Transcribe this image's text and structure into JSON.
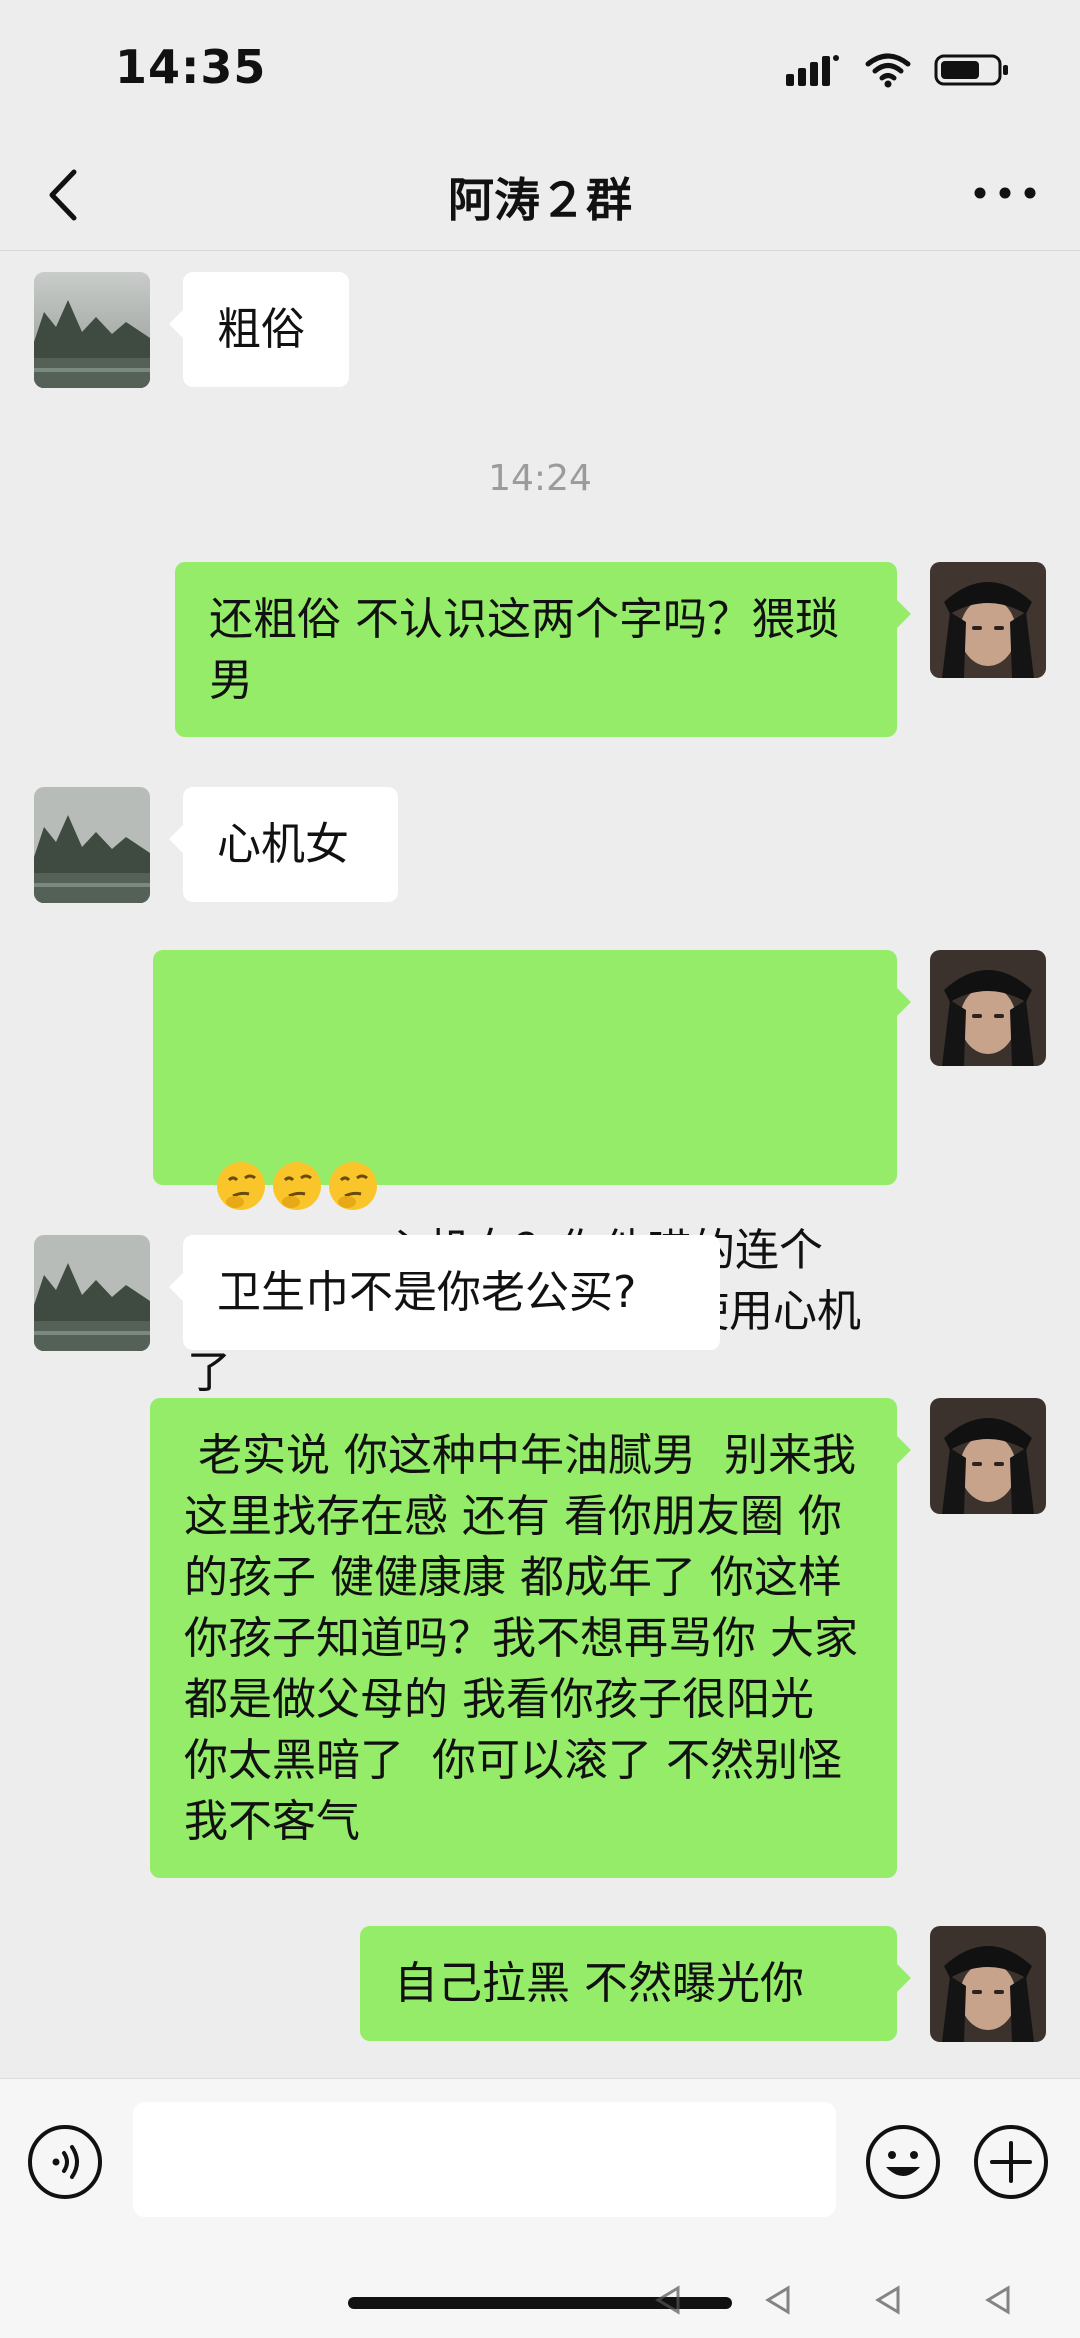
{
  "status_bar": {
    "time": "14:35"
  },
  "nav": {
    "title": "阿涛２群"
  },
  "timestamp": "14:24",
  "messages": [
    {
      "side": "in",
      "text": "粗俗"
    },
    {
      "side": "out",
      "text": "还粗俗 不认识这两个字吗？猥琐男"
    },
    {
      "side": "in",
      "text": "心机女"
    },
    {
      "side": "out",
      "emoji_count": 3,
      "emoji": "thinking-emoji",
      "text": "心机女？你他喵的连个卫生巾都没买过 何来对你使用心机了"
    },
    {
      "side": "in",
      "text": "卫生巾不是你老公买?"
    },
    {
      "side": "out",
      "text": " 老实说 你这种中年油腻男  别来我这里找存在感 还有 看你朋友圈 你的孩子 健健康康 都成年了 你这样 你孩子知道吗？我不想再骂你 大家都是做父母的 我看你孩子很阳光 你太黑暗了  你可以滚了 不然别怪我不客气"
    },
    {
      "side": "out",
      "text": "自己拉黑 不然曝光你"
    }
  ],
  "input": {
    "value": ""
  },
  "icons": {
    "signal": "signal-icon",
    "wifi": "wifi-icon",
    "battery": "battery-icon",
    "back": "back-chevron-icon",
    "more": "more-dots-icon",
    "voice": "voice-icon",
    "emoji": "emoji-icon",
    "plus": "plus-icon"
  },
  "colors": {
    "background": "#ededed",
    "bubble_out": "#95ec69",
    "bubble_in": "#ffffff"
  }
}
